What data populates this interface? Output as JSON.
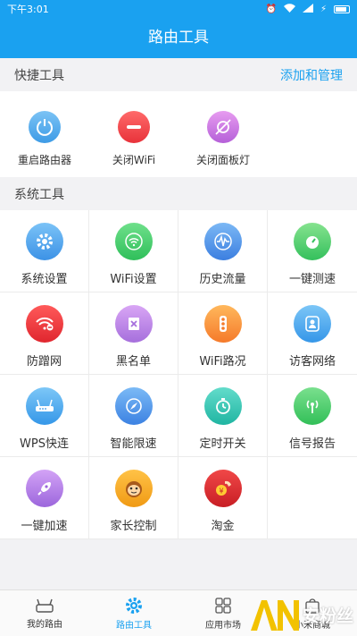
{
  "status_bar": {
    "time": "下午3:01"
  },
  "header": {
    "title": "路由工具"
  },
  "quick_tools": {
    "title": "快捷工具",
    "manage_link": "添加和管理",
    "items": [
      {
        "label": "重启路由器",
        "icon": "power-icon"
      },
      {
        "label": "关闭WiFi",
        "icon": "minus-icon"
      },
      {
        "label": "关闭面板灯",
        "icon": "light-off-icon"
      }
    ]
  },
  "system_tools": {
    "title": "系统工具",
    "items": [
      {
        "label": "系统设置",
        "icon": "gear-icon"
      },
      {
        "label": "WiFi设置",
        "icon": "wifi-icon"
      },
      {
        "label": "历史流量",
        "icon": "wave-icon"
      },
      {
        "label": "一键测速",
        "icon": "speedometer-icon"
      },
      {
        "label": "防蹭网",
        "icon": "wifi-block-icon"
      },
      {
        "label": "黑名单",
        "icon": "blacklist-icon"
      },
      {
        "label": "WiFi路况",
        "icon": "traffic-light-icon"
      },
      {
        "label": "访客网络",
        "icon": "guest-icon"
      },
      {
        "label": "WPS快连",
        "icon": "router-icon"
      },
      {
        "label": "智能限速",
        "icon": "compass-icon"
      },
      {
        "label": "定时开关",
        "icon": "timer-icon"
      },
      {
        "label": "信号报告",
        "icon": "signal-icon"
      },
      {
        "label": "一键加速",
        "icon": "rocket-icon"
      },
      {
        "label": "家长控制",
        "icon": "monkey-icon"
      },
      {
        "label": "淘金",
        "icon": "coin-hand-icon"
      }
    ]
  },
  "bottom_nav": {
    "tabs": [
      {
        "label": "我的路由"
      },
      {
        "label": "路由工具"
      },
      {
        "label": "应用市场"
      },
      {
        "label": "小米商城"
      }
    ]
  },
  "watermark": {
    "text": "安粉丝"
  },
  "colors": {
    "accent": "#1aa1f0"
  }
}
